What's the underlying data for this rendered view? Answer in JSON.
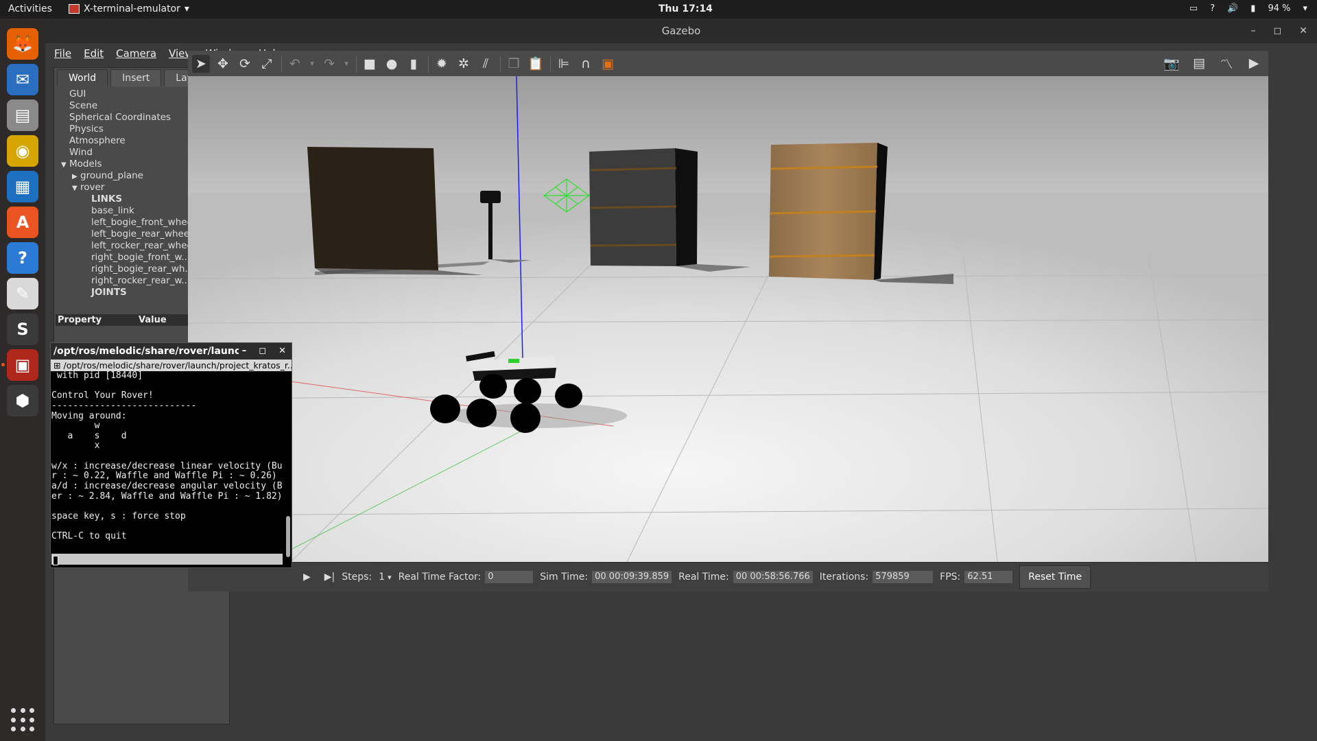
{
  "topbar": {
    "activities": "Activities",
    "app_menu": "X-terminal-emulator",
    "clock": "Thu 17:14",
    "battery": "94 %"
  },
  "dock": {
    "apps": [
      {
        "name": "firefox-icon",
        "color": "#e66000"
      },
      {
        "name": "thunderbird-icon",
        "color": "#2a6fbf"
      },
      {
        "name": "files-icon",
        "color": "#8a8a8a"
      },
      {
        "name": "rhythmbox-icon",
        "color": "#d7a500"
      },
      {
        "name": "libreoffice-writer-icon",
        "color": "#1e6fc0"
      },
      {
        "name": "ubuntu-software-icon",
        "color": "#e95420"
      },
      {
        "name": "help-icon",
        "color": "#2a7ad6"
      },
      {
        "name": "document-viewer-icon",
        "color": "#d9d9d9"
      },
      {
        "name": "sublime-text-icon",
        "color": "#3a3a3a"
      },
      {
        "name": "terminal-icon",
        "color": "#b0281c"
      },
      {
        "name": "virtualbox-icon",
        "color": "#3a3a3a"
      }
    ]
  },
  "window": {
    "title": "Gazebo",
    "menu": [
      "File",
      "Edit",
      "Camera",
      "View",
      "Window",
      "Help"
    ]
  },
  "left_panel": {
    "tabs": [
      "World",
      "Insert",
      "Layers"
    ],
    "active_tab": "World",
    "tree": [
      {
        "label": "GUI",
        "indent": 0,
        "arrow": ""
      },
      {
        "label": "Scene",
        "indent": 0,
        "arrow": ""
      },
      {
        "label": "Spherical Coordinates",
        "indent": 0,
        "arrow": ""
      },
      {
        "label": "Physics",
        "indent": 0,
        "arrow": ""
      },
      {
        "label": "Atmosphere",
        "indent": 0,
        "arrow": ""
      },
      {
        "label": "Wind",
        "indent": 0,
        "arrow": ""
      },
      {
        "label": "Models",
        "indent": 0,
        "arrow": "down"
      },
      {
        "label": "ground_plane",
        "indent": 1,
        "arrow": "right"
      },
      {
        "label": "rover",
        "indent": 1,
        "arrow": "down"
      },
      {
        "label": "LINKS",
        "indent": 2,
        "arrow": "",
        "bold": true
      },
      {
        "label": "base_link",
        "indent": 2,
        "arrow": ""
      },
      {
        "label": "left_bogie_front_wheel",
        "indent": 2,
        "arrow": ""
      },
      {
        "label": "left_bogie_rear_wheel",
        "indent": 2,
        "arrow": ""
      },
      {
        "label": "left_rocker_rear_wheel",
        "indent": 2,
        "arrow": ""
      },
      {
        "label": "right_bogie_front_w...",
        "indent": 2,
        "arrow": ""
      },
      {
        "label": "right_bogie_rear_wh...",
        "indent": 2,
        "arrow": ""
      },
      {
        "label": "right_rocker_rear_w...",
        "indent": 2,
        "arrow": ""
      },
      {
        "label": "JOINTS",
        "indent": 2,
        "arrow": "",
        "bold": true
      }
    ],
    "property_header": "Property",
    "value_header": "Value"
  },
  "bottom_bar": {
    "steps_label": "Steps:",
    "steps_value": "1",
    "rtf_label": "Real Time Factor:",
    "rtf_value": "0",
    "sim_time_label": "Sim Time:",
    "sim_time_value": "00 00:09:39.859",
    "real_time_label": "Real Time:",
    "real_time_value": "00 00:58:56.766",
    "iterations_label": "Iterations:",
    "iterations_value": "579859",
    "fps_label": "FPS:",
    "fps_value": "62.51",
    "reset_label": "Reset Time"
  },
  "terminal": {
    "title": "/opt/ros/melodic/share/rover/launch/proje...",
    "tab_title": "/opt/ros/melodic/share/rover/launch/project_kratos_r...",
    "lines": [
      " with pid [18440]",
      "",
      "Control Your Rover!",
      "---------------------------",
      "Moving around:",
      "        w",
      "   a    s    d",
      "        x",
      "",
      "w/x : increase/decrease linear velocity (Burge",
      "r : ~ 0.22, Waffle and Waffle Pi : ~ 0.26)",
      "a/d : increase/decrease angular velocity (Burg",
      "er : ~ 2.84, Waffle and Waffle Pi : ~ 1.82)",
      "",
      "space key, s : force stop",
      "",
      "CTRL-C to quit"
    ]
  }
}
